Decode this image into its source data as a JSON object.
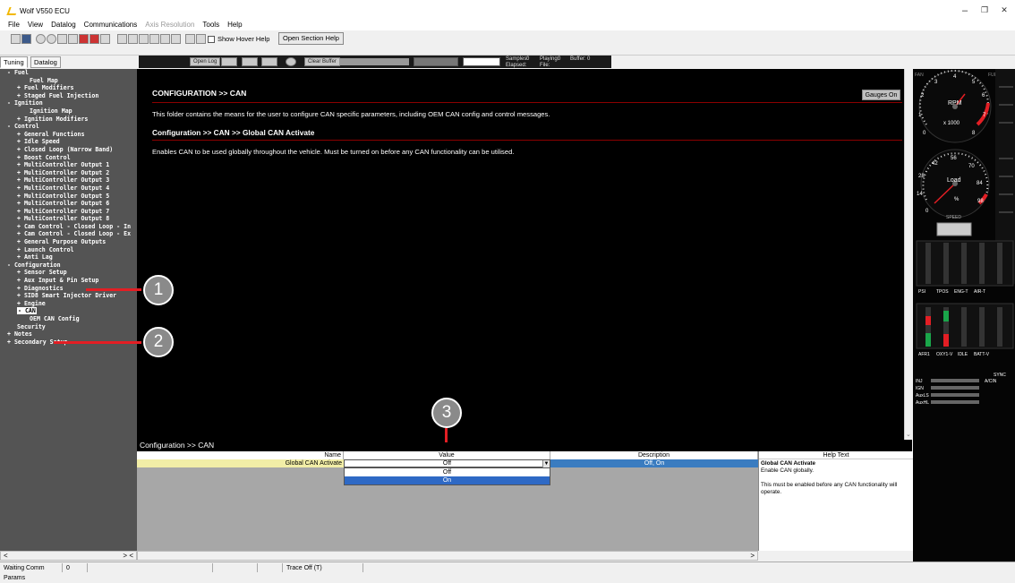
{
  "window": {
    "title": "Wolf V550 ECU",
    "min": "–",
    "max": "❐",
    "close": "✕"
  },
  "menu": [
    "File",
    "View",
    "Datalog",
    "Communications",
    "Axis Resolution",
    "Tools",
    "Help"
  ],
  "toolbar": {
    "show_hover_help": "Show Hover Help",
    "open_section_help": "Open Section Help"
  },
  "tabs": [
    "Tuning",
    "Datalog"
  ],
  "datalog_bar": {
    "open_log": "Open Log",
    "clear_buffer": "Clear Buffer",
    "samples_label": "Samples:",
    "samples_value": "0",
    "playing_label": "Playing:",
    "playing_value": "0",
    "buffer_label": "Buffer:",
    "buffer_value": "0",
    "elapsed_label": "Elapsed:",
    "file_label": "File:"
  },
  "sidebar": {
    "items": [
      {
        "label": "- Fuel",
        "level": 0
      },
      {
        "label": "Fuel Map",
        "level": 2
      },
      {
        "label": "+ Fuel Modifiers",
        "level": 1
      },
      {
        "label": "+ Staged Fuel Injection",
        "level": 1
      },
      {
        "label": "- Ignition",
        "level": 0
      },
      {
        "label": "Ignition Map",
        "level": 2
      },
      {
        "label": "+ Ignition Modifiers",
        "level": 1
      },
      {
        "label": "- Control",
        "level": 0
      },
      {
        "label": "+ General Functions",
        "level": 1
      },
      {
        "label": "+ Idle Speed",
        "level": 1
      },
      {
        "label": "+ Closed Loop (Narrow Band)",
        "level": 1
      },
      {
        "label": "+ Boost Control",
        "level": 1
      },
      {
        "label": "+ MultiController Output 1",
        "level": 1
      },
      {
        "label": "+ MultiController Output 2",
        "level": 1
      },
      {
        "label": "+ MultiController Output 3",
        "level": 1
      },
      {
        "label": "+ MultiController Output 4",
        "level": 1
      },
      {
        "label": "+ MultiController Output 5",
        "level": 1
      },
      {
        "label": "+ MultiController Output 6",
        "level": 1
      },
      {
        "label": "+ MultiController Output 7",
        "level": 1
      },
      {
        "label": "+ MultiController Output 8",
        "level": 1
      },
      {
        "label": "+ Cam Control - Closed Loop - In",
        "level": 1
      },
      {
        "label": "+ Cam Control - Closed Loop - Ex",
        "level": 1
      },
      {
        "label": "+ General Purpose Outputs",
        "level": 1
      },
      {
        "label": "+ Launch Control",
        "level": 1
      },
      {
        "label": "+ Anti Lag",
        "level": 1
      },
      {
        "label": "- Configuration",
        "level": 0
      },
      {
        "label": "+ Sensor Setup",
        "level": 1
      },
      {
        "label": "+ Aux Input & Pin Setup",
        "level": 1
      },
      {
        "label": "+ Diagnostics",
        "level": 1
      },
      {
        "label": "+ SID8 Smart Injector Driver",
        "level": 1
      },
      {
        "label": "+ Engine",
        "level": 1
      },
      {
        "label": "- CAN",
        "level": 1,
        "selected": true
      },
      {
        "label": "OEM CAN Config",
        "level": 2
      },
      {
        "label": "Security",
        "level": 1
      },
      {
        "label": "+ Notes",
        "level": 0
      },
      {
        "label": "+ Secondary Setup",
        "level": 0
      }
    ],
    "scroll_left": "<",
    "scroll_right": "> <"
  },
  "main": {
    "heading": "CONFIGURATION >> CAN",
    "gauges_button": "Gauges On",
    "intro": "This folder contains the means for the user to configure CAN specific parameters, including OEM CAN config and control messages.",
    "sub_heading": "Configuration >> CAN >> Global CAN Activate",
    "sub_text": "Enables CAN to be used globally throughout the vehicle. Must be turned on before any CAN functionality can be utilised."
  },
  "section_header": "Configuration >> CAN",
  "grid": {
    "headers": [
      "Name",
      "Value",
      "Description"
    ],
    "row": {
      "name": "Global CAN Activate",
      "value": "Off",
      "description": "Off, On"
    },
    "dropdown_options": [
      "Off",
      "On"
    ],
    "selected_option": "On"
  },
  "help_panel": {
    "header": "Help Text",
    "title": "Global CAN Activate",
    "line1": "Enable CAN globally.",
    "line2": "This must be enabled before any CAN functionality will operate."
  },
  "status": {
    "text": "Waiting Comm Params",
    "count": "0",
    "trace": "Trace Off (T)"
  },
  "markers": [
    "1",
    "2",
    "3"
  ],
  "gauges": {
    "rpm_label": "RPM",
    "rpm_unit": "x 1000",
    "load_label": "Load",
    "load_unit": "%",
    "speed_label": "SPEED",
    "fan_label": "FAN",
    "fuel_pump_label": "FUEL PUMP",
    "bar_labels_1": [
      "PSI",
      "TPOS",
      "ENG-T",
      "AIR-T"
    ],
    "bar_labels_2": [
      "AFR1",
      "OXY1-V",
      "IDLE",
      "BATT-V"
    ],
    "inj_label": "INJ",
    "ign_label": "IGN",
    "auxls_label": "AuxLS",
    "auxhl_label": "AuxHL",
    "acin_label": "A/CIN",
    "sync_label": "SYNC",
    "rpm_ticks": [
      "0",
      "1",
      "2",
      "3",
      "4",
      "5",
      "6",
      "7",
      "8"
    ],
    "load_ticks": [
      "0",
      "14",
      "28",
      "42",
      "56",
      "70",
      "84",
      "98"
    ]
  },
  "colors": {
    "sidebar_bg": "#545454",
    "accent_red": "#e31e24",
    "selection_blue": "#2e69c5",
    "desc_blue": "#3a7cc0",
    "name_yellow": "#f2eea7"
  }
}
